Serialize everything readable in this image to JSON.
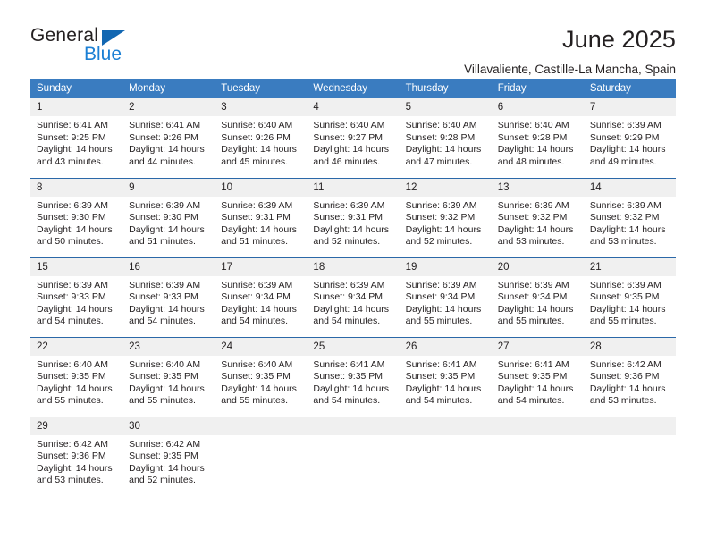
{
  "brand": {
    "name_part1": "General",
    "name_part2": "Blue",
    "triangle_color": "#1267b2",
    "blue_color": "#1b7fd4"
  },
  "header": {
    "title": "June 2025",
    "location": "Villavaliente, Castille-La Mancha, Spain"
  },
  "theme": {
    "header_blue": "#3a7cc0",
    "row_divider_blue": "#2b68a8",
    "daynum_band": "#f0f0f0",
    "text": "#231f20"
  },
  "weekday_headers": [
    "Sunday",
    "Monday",
    "Tuesday",
    "Wednesday",
    "Thursday",
    "Friday",
    "Saturday"
  ],
  "weeks": [
    [
      {
        "day": "1",
        "sunrise": "Sunrise: 6:41 AM",
        "sunset": "Sunset: 9:25 PM",
        "daylight1": "Daylight: 14 hours",
        "daylight2": "and 43 minutes."
      },
      {
        "day": "2",
        "sunrise": "Sunrise: 6:41 AM",
        "sunset": "Sunset: 9:26 PM",
        "daylight1": "Daylight: 14 hours",
        "daylight2": "and 44 minutes."
      },
      {
        "day": "3",
        "sunrise": "Sunrise: 6:40 AM",
        "sunset": "Sunset: 9:26 PM",
        "daylight1": "Daylight: 14 hours",
        "daylight2": "and 45 minutes."
      },
      {
        "day": "4",
        "sunrise": "Sunrise: 6:40 AM",
        "sunset": "Sunset: 9:27 PM",
        "daylight1": "Daylight: 14 hours",
        "daylight2": "and 46 minutes."
      },
      {
        "day": "5",
        "sunrise": "Sunrise: 6:40 AM",
        "sunset": "Sunset: 9:28 PM",
        "daylight1": "Daylight: 14 hours",
        "daylight2": "and 47 minutes."
      },
      {
        "day": "6",
        "sunrise": "Sunrise: 6:40 AM",
        "sunset": "Sunset: 9:28 PM",
        "daylight1": "Daylight: 14 hours",
        "daylight2": "and 48 minutes."
      },
      {
        "day": "7",
        "sunrise": "Sunrise: 6:39 AM",
        "sunset": "Sunset: 9:29 PM",
        "daylight1": "Daylight: 14 hours",
        "daylight2": "and 49 minutes."
      }
    ],
    [
      {
        "day": "8",
        "sunrise": "Sunrise: 6:39 AM",
        "sunset": "Sunset: 9:30 PM",
        "daylight1": "Daylight: 14 hours",
        "daylight2": "and 50 minutes."
      },
      {
        "day": "9",
        "sunrise": "Sunrise: 6:39 AM",
        "sunset": "Sunset: 9:30 PM",
        "daylight1": "Daylight: 14 hours",
        "daylight2": "and 51 minutes."
      },
      {
        "day": "10",
        "sunrise": "Sunrise: 6:39 AM",
        "sunset": "Sunset: 9:31 PM",
        "daylight1": "Daylight: 14 hours",
        "daylight2": "and 51 minutes."
      },
      {
        "day": "11",
        "sunrise": "Sunrise: 6:39 AM",
        "sunset": "Sunset: 9:31 PM",
        "daylight1": "Daylight: 14 hours",
        "daylight2": "and 52 minutes."
      },
      {
        "day": "12",
        "sunrise": "Sunrise: 6:39 AM",
        "sunset": "Sunset: 9:32 PM",
        "daylight1": "Daylight: 14 hours",
        "daylight2": "and 52 minutes."
      },
      {
        "day": "13",
        "sunrise": "Sunrise: 6:39 AM",
        "sunset": "Sunset: 9:32 PM",
        "daylight1": "Daylight: 14 hours",
        "daylight2": "and 53 minutes."
      },
      {
        "day": "14",
        "sunrise": "Sunrise: 6:39 AM",
        "sunset": "Sunset: 9:32 PM",
        "daylight1": "Daylight: 14 hours",
        "daylight2": "and 53 minutes."
      }
    ],
    [
      {
        "day": "15",
        "sunrise": "Sunrise: 6:39 AM",
        "sunset": "Sunset: 9:33 PM",
        "daylight1": "Daylight: 14 hours",
        "daylight2": "and 54 minutes."
      },
      {
        "day": "16",
        "sunrise": "Sunrise: 6:39 AM",
        "sunset": "Sunset: 9:33 PM",
        "daylight1": "Daylight: 14 hours",
        "daylight2": "and 54 minutes."
      },
      {
        "day": "17",
        "sunrise": "Sunrise: 6:39 AM",
        "sunset": "Sunset: 9:34 PM",
        "daylight1": "Daylight: 14 hours",
        "daylight2": "and 54 minutes."
      },
      {
        "day": "18",
        "sunrise": "Sunrise: 6:39 AM",
        "sunset": "Sunset: 9:34 PM",
        "daylight1": "Daylight: 14 hours",
        "daylight2": "and 54 minutes."
      },
      {
        "day": "19",
        "sunrise": "Sunrise: 6:39 AM",
        "sunset": "Sunset: 9:34 PM",
        "daylight1": "Daylight: 14 hours",
        "daylight2": "and 55 minutes."
      },
      {
        "day": "20",
        "sunrise": "Sunrise: 6:39 AM",
        "sunset": "Sunset: 9:34 PM",
        "daylight1": "Daylight: 14 hours",
        "daylight2": "and 55 minutes."
      },
      {
        "day": "21",
        "sunrise": "Sunrise: 6:39 AM",
        "sunset": "Sunset: 9:35 PM",
        "daylight1": "Daylight: 14 hours",
        "daylight2": "and 55 minutes."
      }
    ],
    [
      {
        "day": "22",
        "sunrise": "Sunrise: 6:40 AM",
        "sunset": "Sunset: 9:35 PM",
        "daylight1": "Daylight: 14 hours",
        "daylight2": "and 55 minutes."
      },
      {
        "day": "23",
        "sunrise": "Sunrise: 6:40 AM",
        "sunset": "Sunset: 9:35 PM",
        "daylight1": "Daylight: 14 hours",
        "daylight2": "and 55 minutes."
      },
      {
        "day": "24",
        "sunrise": "Sunrise: 6:40 AM",
        "sunset": "Sunset: 9:35 PM",
        "daylight1": "Daylight: 14 hours",
        "daylight2": "and 55 minutes."
      },
      {
        "day": "25",
        "sunrise": "Sunrise: 6:41 AM",
        "sunset": "Sunset: 9:35 PM",
        "daylight1": "Daylight: 14 hours",
        "daylight2": "and 54 minutes."
      },
      {
        "day": "26",
        "sunrise": "Sunrise: 6:41 AM",
        "sunset": "Sunset: 9:35 PM",
        "daylight1": "Daylight: 14 hours",
        "daylight2": "and 54 minutes."
      },
      {
        "day": "27",
        "sunrise": "Sunrise: 6:41 AM",
        "sunset": "Sunset: 9:35 PM",
        "daylight1": "Daylight: 14 hours",
        "daylight2": "and 54 minutes."
      },
      {
        "day": "28",
        "sunrise": "Sunrise: 6:42 AM",
        "sunset": "Sunset: 9:36 PM",
        "daylight1": "Daylight: 14 hours",
        "daylight2": "and 53 minutes."
      }
    ],
    [
      {
        "day": "29",
        "sunrise": "Sunrise: 6:42 AM",
        "sunset": "Sunset: 9:36 PM",
        "daylight1": "Daylight: 14 hours",
        "daylight2": "and 53 minutes."
      },
      {
        "day": "30",
        "sunrise": "Sunrise: 6:42 AM",
        "sunset": "Sunset: 9:35 PM",
        "daylight1": "Daylight: 14 hours",
        "daylight2": "and 52 minutes."
      },
      {
        "day": "",
        "sunrise": "",
        "sunset": "",
        "daylight1": "",
        "daylight2": ""
      },
      {
        "day": "",
        "sunrise": "",
        "sunset": "",
        "daylight1": "",
        "daylight2": ""
      },
      {
        "day": "",
        "sunrise": "",
        "sunset": "",
        "daylight1": "",
        "daylight2": ""
      },
      {
        "day": "",
        "sunrise": "",
        "sunset": "",
        "daylight1": "",
        "daylight2": ""
      },
      {
        "day": "",
        "sunrise": "",
        "sunset": "",
        "daylight1": "",
        "daylight2": ""
      }
    ]
  ]
}
